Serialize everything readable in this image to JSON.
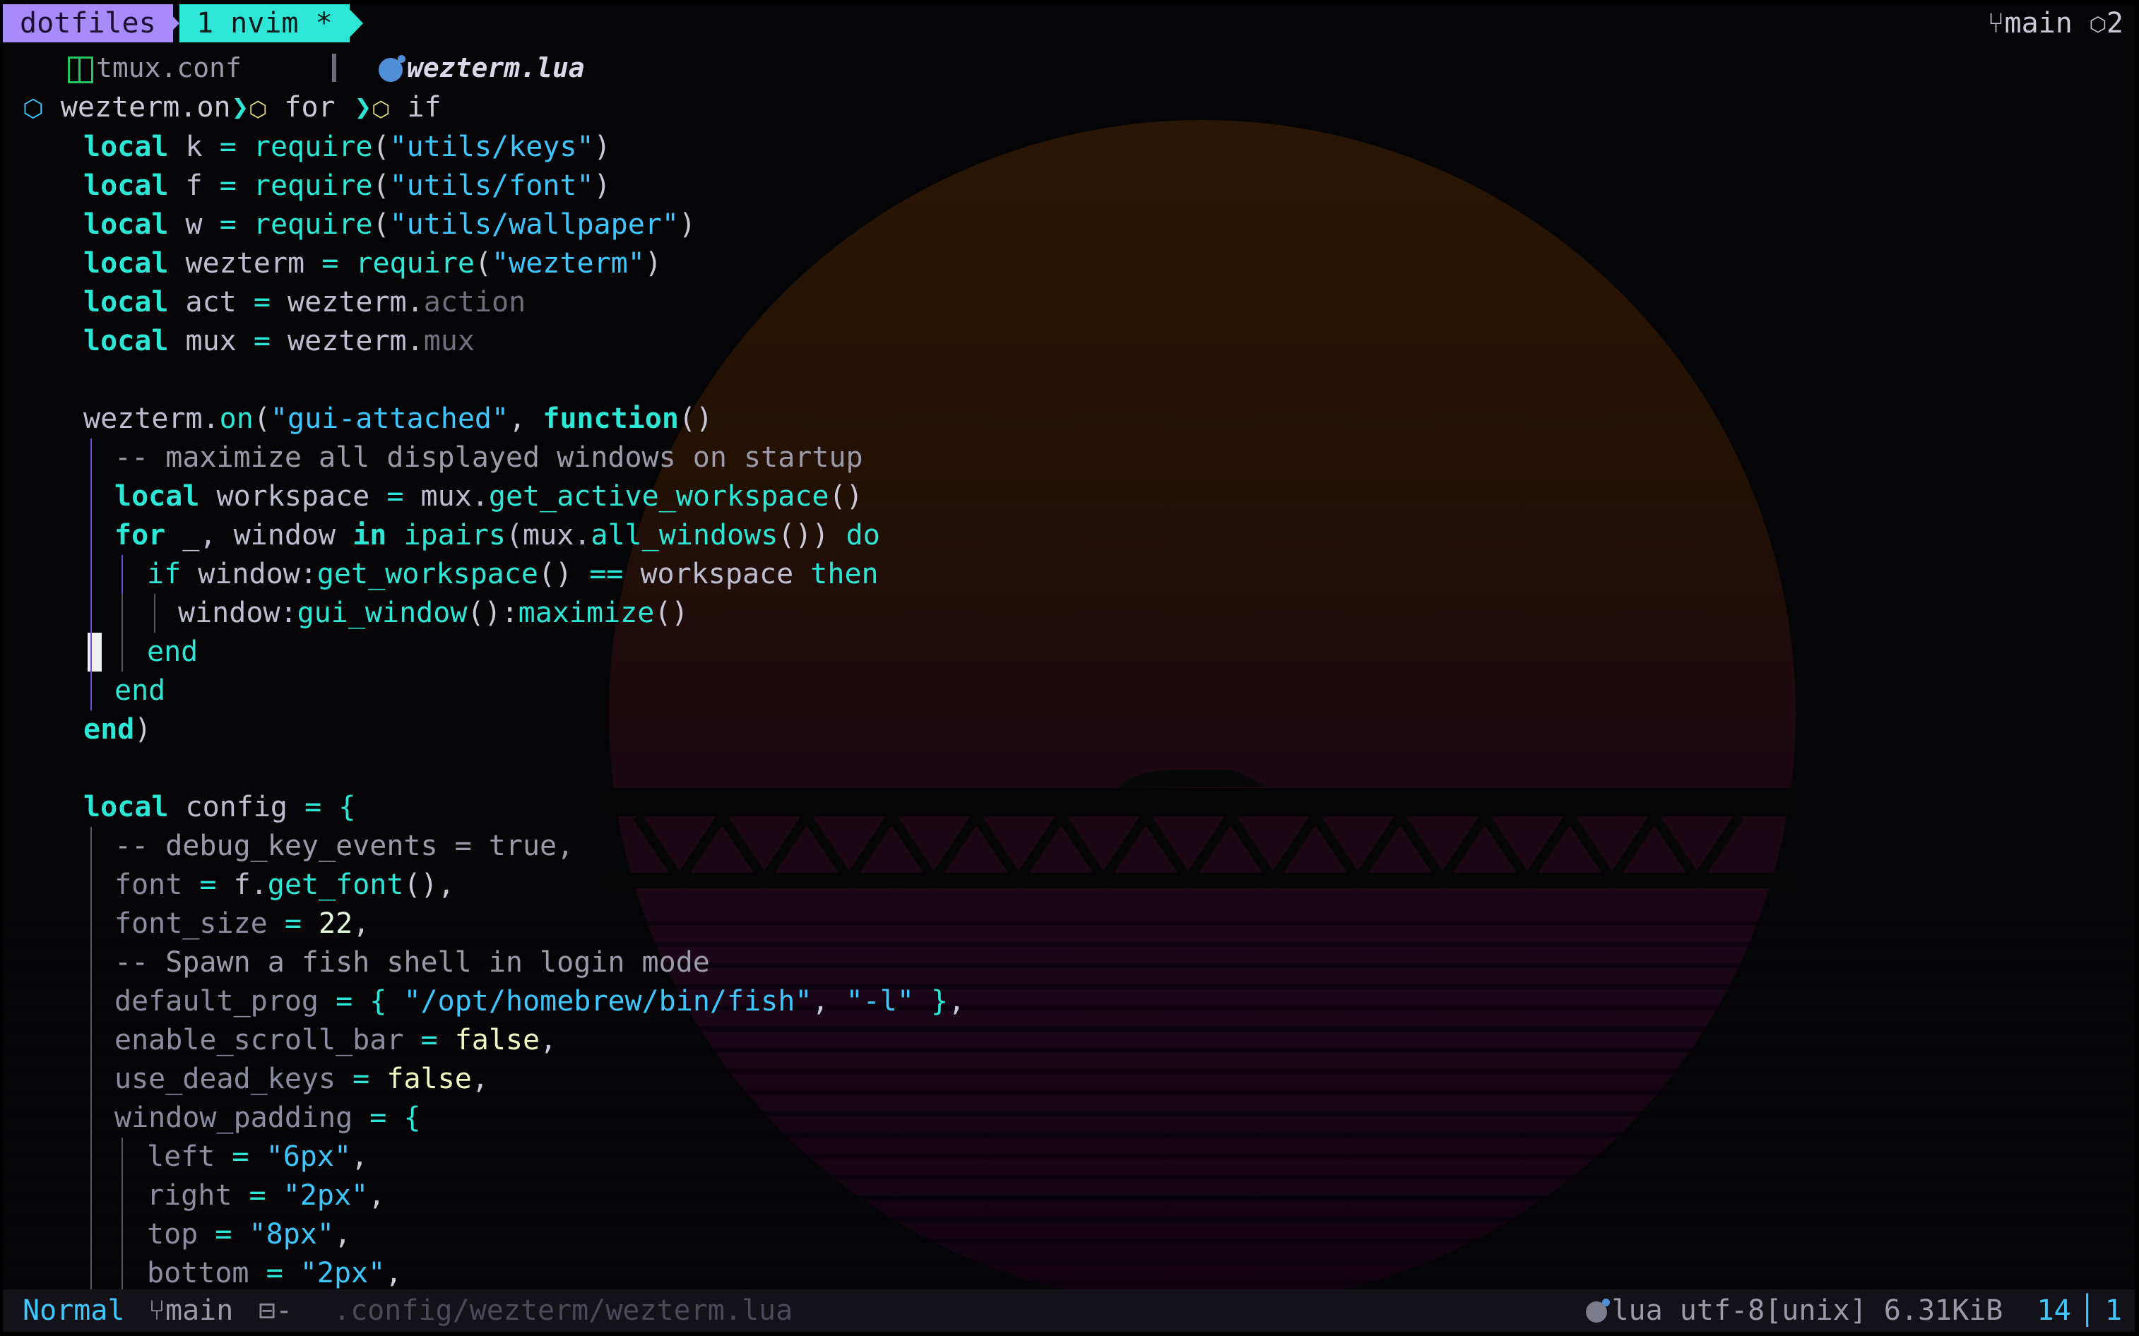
{
  "tmux": {
    "session": "dotfiles",
    "window": "1 nvim *",
    "branch": "main",
    "count": "2"
  },
  "tabs": {
    "inactive": "tmux.conf",
    "active": "wezterm.lua"
  },
  "winbar": {
    "item1": "wezterm.on",
    "item2": "for",
    "item3": "if"
  },
  "statusline": {
    "mode": "Normal",
    "branch": "main",
    "diff": "-",
    "path": ".config/wezterm/wezterm.lua",
    "filetype": "lua",
    "encoding": "utf-8[unix]",
    "size": "6.31KiB",
    "line": "14",
    "col": "1"
  },
  "code": {
    "l1": [
      "local",
      "k",
      "=",
      "require",
      "(",
      "\"utils/keys\"",
      ")"
    ],
    "l2": [
      "local",
      "f",
      "=",
      "require",
      "(",
      "\"utils/font\"",
      ")"
    ],
    "l3": [
      "local",
      "w",
      "=",
      "require",
      "(",
      "\"utils/wallpaper\"",
      ")"
    ],
    "l4": [
      "local",
      "wezterm",
      "=",
      "require",
      "(",
      "\"wezterm\"",
      ")"
    ],
    "l5": [
      "local",
      "act",
      "=",
      "wezterm.",
      "action"
    ],
    "l6": [
      "local",
      "mux",
      "=",
      "wezterm.",
      "mux"
    ],
    "l8": [
      "wezterm.",
      "on",
      "(",
      "\"gui-attached\"",
      ", ",
      "function",
      "()"
    ],
    "l9": "-- maximize all displayed windows on startup",
    "l10": [
      "local",
      "workspace",
      "=",
      "mux.",
      "get_active_workspace",
      "()"
    ],
    "l11": [
      "for",
      "_, window",
      "in",
      "ipairs",
      "(mux.",
      "all_windows",
      "())",
      "do"
    ],
    "l12": [
      "if",
      "window:",
      "get_workspace",
      "()",
      "==",
      "workspace",
      "then"
    ],
    "l13": [
      "window:",
      "gui_window",
      "():",
      "maximize",
      "()"
    ],
    "l14": "end",
    "l15": "end",
    "l16": [
      "end",
      ")"
    ],
    "l18": [
      "local",
      "config",
      "=",
      "{"
    ],
    "l19": "-- debug_key_events = true,",
    "l20": [
      "font",
      "=",
      "f.",
      "get_font",
      "(),"
    ],
    "l21": [
      "font_size",
      "=",
      "22",
      ","
    ],
    "l22": "-- Spawn a fish shell in login mode",
    "l23": [
      "default_prog",
      "=",
      "{",
      "\"/opt/homebrew/bin/fish\"",
      ", ",
      "\"-l\"",
      "}",
      ","
    ],
    "l24": [
      "enable_scroll_bar",
      "=",
      "false",
      ","
    ],
    "l25": [
      "use_dead_keys",
      "=",
      "false",
      ","
    ],
    "l26": [
      "window_padding",
      "=",
      "{"
    ],
    "l27": [
      "left",
      "=",
      "\"6px\"",
      ","
    ],
    "l28": [
      "right",
      "=",
      "\"2px\"",
      ","
    ],
    "l29": [
      "top",
      "=",
      "\"8px\"",
      ","
    ],
    "l30": [
      "bottom",
      "=",
      "\"2px\"",
      ","
    ]
  },
  "colors": {
    "accent": "#2ee6d6",
    "session": "#a78bfa",
    "string": "#3ec7ff",
    "guide": "#6d4bd8"
  }
}
